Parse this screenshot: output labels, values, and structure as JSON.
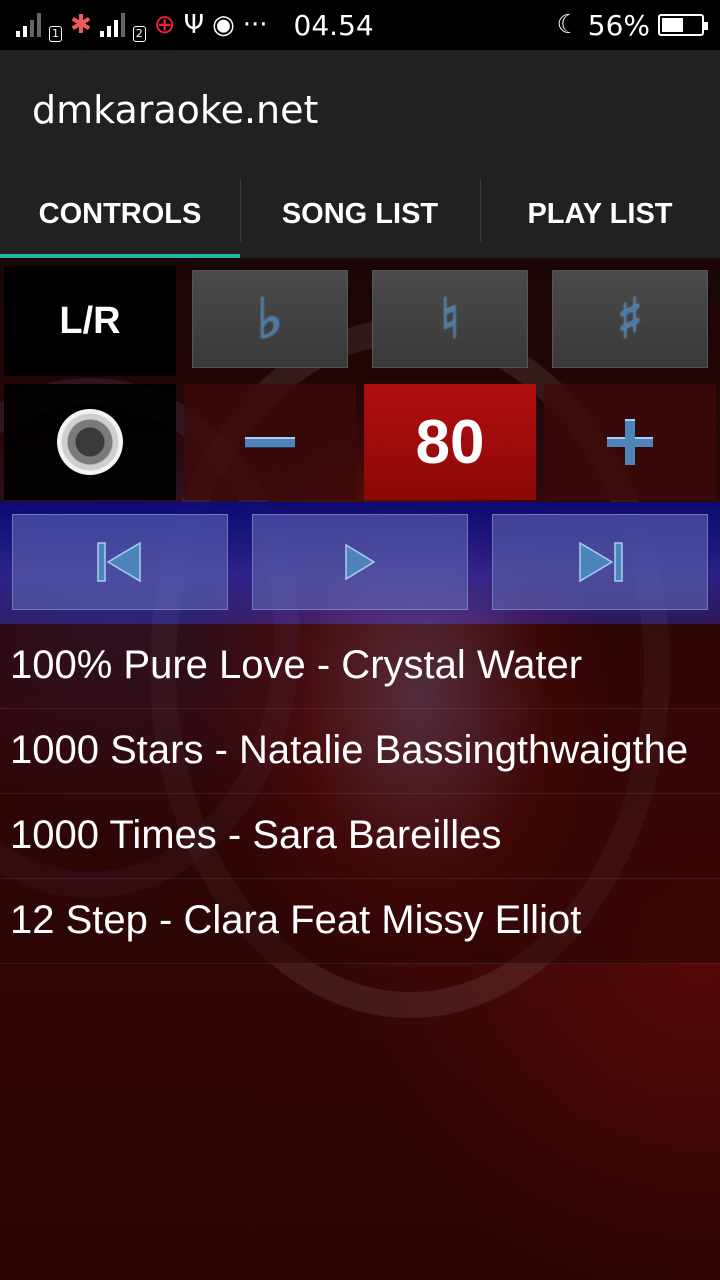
{
  "status_bar": {
    "sim1": "1",
    "sim2": "2",
    "more": "···",
    "time": "04.54",
    "battery": "56%",
    "battery_level": 0.56,
    "icons": [
      "signal-icon",
      "pinwheel-icon",
      "signal-icon",
      "radar-icon",
      "usb-icon",
      "wifi-hotspot-icon",
      "night-mode-icon",
      "battery-icon"
    ]
  },
  "app": {
    "title": "dmkaraoke.net"
  },
  "tabs": [
    {
      "label": "CONTROLS",
      "active": true
    },
    {
      "label": "SONG LIST",
      "active": false
    },
    {
      "label": "PLAY LIST",
      "active": false
    }
  ],
  "controls": {
    "channel_label": "L/R",
    "flat_symbol": "♭",
    "natural_symbol": "♮",
    "sharp_symbol": "♯",
    "volume_value": "80"
  },
  "songs": [
    "100% Pure Love - Crystal Water",
    "1000 Stars - Natalie Bassingthwaigthe",
    "1000 Times - Sara Bareilles",
    "12 Step - Clara Feat Missy Elliot"
  ],
  "colors": {
    "tab_indicator": "#22b5a6",
    "title_bar": "#212121",
    "volume_value_bg": "#b20e0e",
    "transport_bg": "#1a1a9a"
  }
}
